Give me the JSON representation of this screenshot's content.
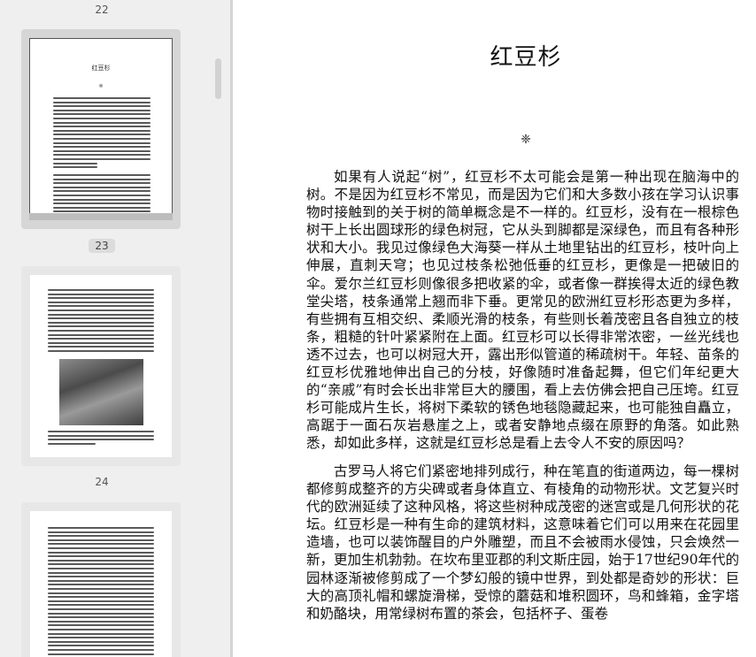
{
  "sidebar": {
    "pages": [
      {
        "number": "22"
      },
      {
        "number": "23",
        "thumb_title": "红豆杉"
      },
      {
        "number": "24"
      }
    ],
    "thumb_captions": {
      "page23_title": "红豆杉",
      "page24_star": "❈"
    }
  },
  "document": {
    "title": "红豆杉",
    "ornament": "❈",
    "paragraphs": [
      "如果有人说起“树”，红豆杉不太可能会是第一种出现在脑海中的树。不是因为红豆杉不常见，而是因为它们和大多数小孩在学习认识事物时接触到的关于树的简单概念是不一样的。红豆杉，没有在一根棕色树干上长出圆球形的绿色树冠，它从头到脚都是深绿色，而且有各种形状和大小。我见过像绿色大海葵一样从土地里钻出的红豆杉，枝叶向上伸展，直刺天穹；也见过枝条松弛低垂的红豆杉，更像是一把破旧的伞。爱尔兰红豆杉则像很多把收紧的伞，或者像一群挨得太近的绿色教堂尖塔，枝条通常上翘而非下垂。更常见的欧洲红豆杉形态更为多样，有些拥有互相交织、柔顺光滑的枝条，有些则长着茂密且各自独立的枝条，粗糙的针叶紧紧附在上面。红豆杉可以长得非常浓密，一丝光线也透不过去，也可以树冠大开，露出形似管道的稀疏树干。年轻、苗条的红豆杉优雅地伸出自己的分枝，好像随时准备起舞，但它们年纪更大的“亲戚”有时会长出非常巨大的腰围，看上去仿佛会把自己压垮。红豆杉可能成片生长，将树下柔软的锈色地毯隐藏起来，也可能独自矗立，高踞于一面石灰岩悬崖之上，或者安静地点缀在原野的角落。如此熟悉，却如此多样，这就是红豆杉总是看上去令人不安的原因吗？",
      "古罗马人将它们紧密地排列成行，种在笔直的街道两边，每一棵树都修剪成整齐的方尖碑或者身体直立、有棱角的动物形状。文艺复兴时代的欧洲延续了这种风格，将这些树种成茂密的迷宫或是几何形状的花坛。红豆杉是一种有生命的建筑材料，这意味着它们可以用来在花园里造墙，也可以装饰醒目的户外雕塑，而且不会被雨水侵蚀，只会焕然一新，更加生机勃勃。在坎布里亚郡的利文斯庄园，始于17世纪90年代的园林逐渐被修剪成了一个梦幻般的镜中世界，到处都是奇妙的形状：巨大的高顶礼帽和螺旋滑梯，受惊的蘑菇和堆积圆环，鸟和蜂箱，金字塔和奶酪块，用常绿树布置的茶会，包括杯子、蛋卷"
    ]
  }
}
